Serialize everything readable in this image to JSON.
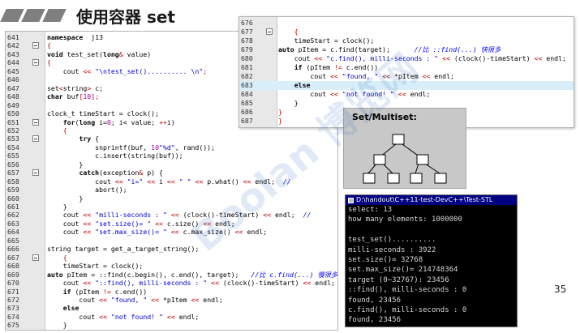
{
  "slide": {
    "title": "使用容器 set",
    "page_number": "35",
    "watermark": "Boolan 博览网"
  },
  "left_code": {
    "lines": [
      {
        "n": "641",
        "fold": false,
        "t": [
          [
            "kw",
            "namespace"
          ],
          [
            "",
            "  j13"
          ]
        ]
      },
      {
        "n": "642",
        "fold": true,
        "t": [
          [
            "op",
            "{"
          ]
        ]
      },
      {
        "n": "643",
        "fold": false,
        "t": [
          [
            "kw",
            "void"
          ],
          [
            "",
            " test_set("
          ],
          [
            "kw",
            "long"
          ],
          [
            "op",
            "&"
          ],
          [
            "",
            " value)"
          ]
        ]
      },
      {
        "n": "644",
        "fold": true,
        "t": [
          [
            "op",
            "{"
          ]
        ]
      },
      {
        "n": "645",
        "fold": false,
        "t": [
          [
            "",
            "    cout "
          ],
          [
            "op",
            "<<"
          ],
          [
            "",
            " "
          ],
          [
            "str",
            "\"\\ntest_set().......... \\n\""
          ],
          [
            "op",
            ";"
          ]
        ]
      },
      {
        "n": "646",
        "fold": false,
        "t": [
          [
            "",
            ""
          ]
        ]
      },
      {
        "n": "647",
        "fold": false,
        "t": [
          [
            "",
            "set"
          ],
          [
            "op",
            "<"
          ],
          [
            "",
            "string"
          ],
          [
            "op",
            ">"
          ],
          [
            "",
            " c;"
          ]
        ]
      },
      {
        "n": "648",
        "fold": false,
        "t": [
          [
            "kw",
            "char"
          ],
          [
            "",
            " buf"
          ],
          [
            "op",
            "["
          ],
          [
            "num",
            "10"
          ],
          [
            "op",
            "];"
          ]
        ]
      },
      {
        "n": "649",
        "fold": false,
        "t": [
          [
            "",
            ""
          ]
        ]
      },
      {
        "n": "650",
        "fold": false,
        "t": [
          [
            "",
            "clock_t timeStart = clock();"
          ]
        ]
      },
      {
        "n": "651",
        "fold": true,
        "t": [
          [
            "",
            "    "
          ],
          [
            "kw",
            "for"
          ],
          [
            "",
            "("
          ],
          [
            "kw",
            "long"
          ],
          [
            "",
            " i="
          ],
          [
            "num",
            "0"
          ],
          [
            "",
            "; i< value; "
          ],
          [
            "op",
            "++"
          ],
          [
            "",
            "i)"
          ]
        ]
      },
      {
        "n": "652",
        "fold": false,
        "t": [
          [
            "",
            "    "
          ],
          [
            "op",
            "{"
          ]
        ]
      },
      {
        "n": "653",
        "fold": true,
        "t": [
          [
            "",
            "        "
          ],
          [
            "kw",
            "try"
          ],
          [
            "",
            " {"
          ]
        ]
      },
      {
        "n": "654",
        "fold": false,
        "t": [
          [
            "",
            "            snprintf(buf, "
          ],
          [
            "num",
            "10"
          ],
          [
            ", "
          ],
          [
            "str",
            "\"%d\""
          ],
          [
            "",
            ", rand());"
          ]
        ]
      },
      {
        "n": "655",
        "fold": false,
        "t": [
          [
            "",
            "            c.insert(string(buf));"
          ]
        ]
      },
      {
        "n": "656",
        "fold": false,
        "t": [
          [
            "",
            "        }"
          ]
        ]
      },
      {
        "n": "657",
        "fold": true,
        "t": [
          [
            "",
            "        "
          ],
          [
            "kw",
            "catch"
          ],
          [
            "",
            "(exception"
          ],
          [
            "op",
            "&"
          ],
          [
            "",
            " p) {"
          ]
        ]
      },
      {
        "n": "658",
        "fold": false,
        "t": [
          [
            "",
            "            cout "
          ],
          [
            "op",
            "<<"
          ],
          [
            "",
            " "
          ],
          [
            "str",
            "\"i=\""
          ],
          [
            "",
            " "
          ],
          [
            "op",
            "<<"
          ],
          [
            "",
            " i "
          ],
          [
            "op",
            "<<"
          ],
          [
            "",
            " "
          ],
          [
            "str",
            "\" \""
          ],
          [
            "",
            " "
          ],
          [
            "op",
            "<<"
          ],
          [
            "",
            " p.what() "
          ],
          [
            "op",
            "<<"
          ],
          [
            "",
            " endl;  "
          ],
          [
            "cmt",
            "//"
          ]
        ]
      },
      {
        "n": "659",
        "fold": false,
        "t": [
          [
            "",
            "            abort();"
          ]
        ]
      },
      {
        "n": "660",
        "fold": false,
        "t": [
          [
            "",
            "        }"
          ]
        ]
      },
      {
        "n": "661",
        "fold": false,
        "t": [
          [
            "",
            "    }"
          ]
        ]
      },
      {
        "n": "662",
        "fold": false,
        "t": [
          [
            "",
            "    cout "
          ],
          [
            "op",
            "<<"
          ],
          [
            "",
            " "
          ],
          [
            "str",
            "\"milli-seconds : \""
          ],
          [
            "",
            " "
          ],
          [
            "op",
            "<<"
          ],
          [
            "",
            " (clock()-timeStart) "
          ],
          [
            "op",
            "<<"
          ],
          [
            "",
            " endl;  "
          ],
          [
            "cmt",
            "//"
          ]
        ]
      },
      {
        "n": "663",
        "fold": false,
        "t": [
          [
            "",
            "    cout "
          ],
          [
            "op",
            "<<"
          ],
          [
            "",
            " "
          ],
          [
            "str",
            "\"set.size()= \""
          ],
          [
            "",
            " "
          ],
          [
            "op",
            "<<"
          ],
          [
            "",
            " c.size() "
          ],
          [
            "op",
            "<<"
          ],
          [
            "",
            " endl;"
          ]
        ]
      },
      {
        "n": "664",
        "fold": false,
        "t": [
          [
            "",
            "    cout "
          ],
          [
            "op",
            "<<"
          ],
          [
            "",
            " "
          ],
          [
            "str",
            "\"set.max_size()= \""
          ],
          [
            "",
            " "
          ],
          [
            "op",
            "<<"
          ],
          [
            "",
            " c.max_size() "
          ],
          [
            "op",
            "<<"
          ],
          [
            "",
            " endl;"
          ]
        ]
      },
      {
        "n": "665",
        "fold": false,
        "t": [
          [
            "",
            ""
          ]
        ]
      },
      {
        "n": "666",
        "fold": false,
        "t": [
          [
            "",
            "string target = get_a_target_string();"
          ]
        ]
      },
      {
        "n": "667",
        "fold": true,
        "t": [
          [
            "",
            "    "
          ],
          [
            "op",
            "{"
          ]
        ]
      },
      {
        "n": "668",
        "fold": false,
        "t": [
          [
            "",
            "    timeStart = clock();"
          ]
        ]
      },
      {
        "n": "669",
        "fold": false,
        "t": [
          [
            "kw",
            "auto"
          ],
          [
            "",
            " pItem = ::find(c.begin(), c.end(), target);   "
          ],
          [
            "cmt",
            "//比 c.find(...) 慢很多"
          ]
        ]
      },
      {
        "n": "670",
        "fold": false,
        "t": [
          [
            "",
            "    cout "
          ],
          [
            "op",
            "<<"
          ],
          [
            "",
            " "
          ],
          [
            "str",
            "\"::find(), milli-seconds : \""
          ],
          [
            "",
            " "
          ],
          [
            "op",
            "<<"
          ],
          [
            "",
            " (clock()-timeStart) "
          ],
          [
            "op",
            "<<"
          ],
          [
            "",
            " endl;"
          ]
        ]
      },
      {
        "n": "671",
        "fold": false,
        "t": [
          [
            "",
            "    "
          ],
          [
            "kw",
            "if"
          ],
          [
            "",
            " (pItem "
          ],
          [
            "op",
            "!="
          ],
          [
            "",
            " c.end())"
          ]
        ]
      },
      {
        "n": "672",
        "fold": false,
        "t": [
          [
            "",
            "        cout "
          ],
          [
            "op",
            "<<"
          ],
          [
            "",
            " "
          ],
          [
            "str",
            "\"found, \""
          ],
          [
            "",
            " "
          ],
          [
            "op",
            "<<"
          ],
          [
            "",
            " *pItem "
          ],
          [
            "op",
            "<<"
          ],
          [
            "",
            " endl;"
          ]
        ]
      },
      {
        "n": "673",
        "fold": false,
        "t": [
          [
            "",
            "    "
          ],
          [
            "kw",
            "else"
          ]
        ]
      },
      {
        "n": "674",
        "fold": false,
        "t": [
          [
            "",
            "        cout "
          ],
          [
            "op",
            "<<"
          ],
          [
            "",
            " "
          ],
          [
            "str",
            "\"not found! \""
          ],
          [
            "",
            " "
          ],
          [
            "op",
            "<<"
          ],
          [
            "",
            " endl;"
          ]
        ]
      },
      {
        "n": "675",
        "fold": false,
        "t": [
          [
            "",
            "    }"
          ]
        ]
      }
    ]
  },
  "right_code": {
    "lines": [
      {
        "n": "676",
        "fold": false,
        "hl": false,
        "t": [
          [
            "",
            ""
          ]
        ]
      },
      {
        "n": "677",
        "fold": true,
        "hl": false,
        "t": [
          [
            "",
            "    "
          ],
          [
            "op",
            "{"
          ]
        ]
      },
      {
        "n": "678",
        "fold": false,
        "hl": false,
        "t": [
          [
            "",
            "    timeStart = clock();"
          ]
        ]
      },
      {
        "n": "679",
        "fold": false,
        "hl": false,
        "t": [
          [
            "kw",
            "auto"
          ],
          [
            "",
            " pItem = c.find(target);      "
          ],
          [
            "cmt",
            "//比 ::find(...) 快很多"
          ]
        ]
      },
      {
        "n": "680",
        "fold": false,
        "hl": false,
        "t": [
          [
            "",
            "    cout "
          ],
          [
            "op",
            "<<"
          ],
          [
            "",
            " "
          ],
          [
            "str",
            "\"c.find(), milli-seconds : \""
          ],
          [
            "",
            " "
          ],
          [
            "op",
            "<<"
          ],
          [
            "",
            " (clock()-timeStart) "
          ],
          [
            "op",
            "<<"
          ],
          [
            "",
            " endl;"
          ]
        ]
      },
      {
        "n": "681",
        "fold": false,
        "hl": false,
        "t": [
          [
            "",
            "    "
          ],
          [
            "kw",
            "if"
          ],
          [
            "",
            " (pItem "
          ],
          [
            "op",
            "!="
          ],
          [
            "",
            " c.end())"
          ]
        ]
      },
      {
        "n": "682",
        "fold": false,
        "hl": false,
        "t": [
          [
            "",
            "        cout "
          ],
          [
            "op",
            "<<"
          ],
          [
            "",
            " "
          ],
          [
            "str",
            "\"found, \""
          ],
          [
            "",
            " "
          ],
          [
            "op",
            "<<"
          ],
          [
            "",
            " *pItem "
          ],
          [
            "op",
            "<<"
          ],
          [
            "",
            " endl;"
          ]
        ]
      },
      {
        "n": "683",
        "fold": false,
        "hl": true,
        "t": [
          [
            "",
            "    "
          ],
          [
            "kw",
            "else"
          ]
        ]
      },
      {
        "n": "684",
        "fold": false,
        "hl": false,
        "t": [
          [
            "",
            "        cout "
          ],
          [
            "op",
            "<<"
          ],
          [
            "",
            " "
          ],
          [
            "str",
            "\"not found! \""
          ],
          [
            "",
            " "
          ],
          [
            "op",
            "<<"
          ],
          [
            "",
            " endl;"
          ]
        ]
      },
      {
        "n": "685",
        "fold": false,
        "hl": false,
        "t": [
          [
            "",
            "    }"
          ]
        ]
      },
      {
        "n": "686",
        "fold": false,
        "hl": false,
        "t": [
          [
            "",
            ""
          ],
          [
            "op",
            "}"
          ]
        ]
      },
      {
        "n": "687",
        "fold": false,
        "hl": false,
        "t": [
          [
            "op",
            "}"
          ]
        ]
      }
    ]
  },
  "tree": {
    "label": "Set/Multiset:"
  },
  "console": {
    "title": "D:\\handout\\C++11-test-DevC++\\Test-STL",
    "lines": [
      "select: 13",
      "how many elements: 1000000",
      "",
      "test_set()..........",
      "milli-seconds : 3922",
      "set.size()= 32768",
      "set.max_size()= 214748364",
      "target (0~32767): 23456",
      "::find(), milli-seconds : 0",
      "found, 23456",
      "c.find(), milli-seconds : 0",
      "found, 23456"
    ]
  }
}
